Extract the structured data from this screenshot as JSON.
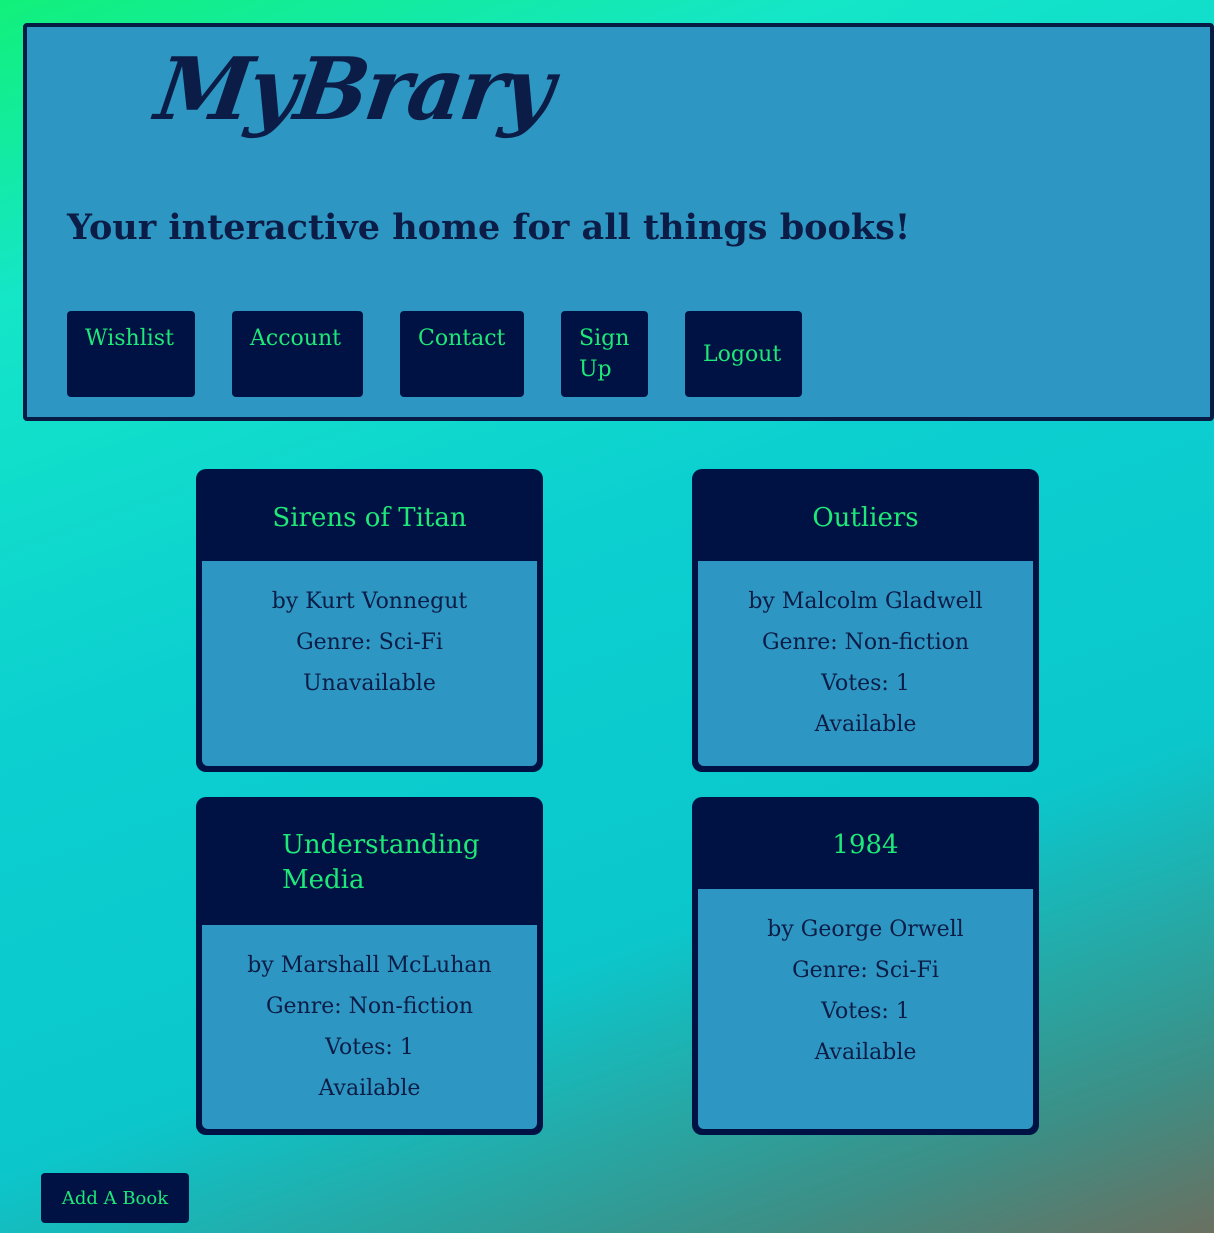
{
  "header": {
    "logo": "MyBrary",
    "tagline": "Your interactive home for all things books!",
    "nav": [
      {
        "label": "Wishlist"
      },
      {
        "label": "Account"
      },
      {
        "label": "Contact"
      },
      {
        "label": "Sign Up"
      },
      {
        "label": "Logout"
      }
    ]
  },
  "books": [
    {
      "title": "Sirens of Titan",
      "author": "by Kurt Vonnegut",
      "genre": "Genre: Sci-Fi",
      "status": "Unavailable"
    },
    {
      "title": "Outliers",
      "author": "by Malcolm Gladwell",
      "genre": "Genre: Non-fiction",
      "votes": "Votes: 1",
      "status": "Available"
    },
    {
      "title": "Understanding Media",
      "author": "by Marshall McLuhan",
      "genre": "Genre: Non-fiction",
      "votes": "Votes: 1",
      "status": "Available"
    },
    {
      "title": "1984",
      "author": "by George Orwell",
      "genre": "Genre: Sci-Fi",
      "votes": "Votes: 1",
      "status": "Available"
    }
  ],
  "actions": {
    "add_book_label": "Add A Book"
  },
  "colors": {
    "header_bg": "#2e96c2",
    "dark_navy": "#001244",
    "accent_green": "#1ee878",
    "text_navy": "#0b1d47"
  }
}
